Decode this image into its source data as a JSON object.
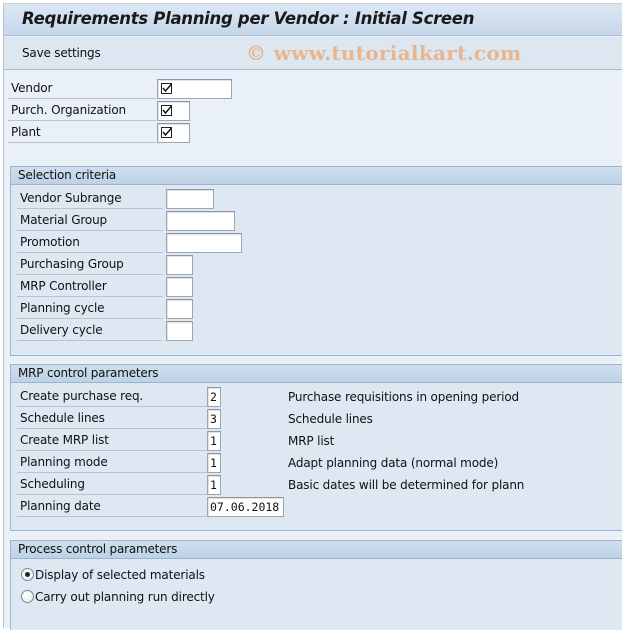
{
  "window": {
    "title": "Requirements Planning per Vendor : Initial Screen"
  },
  "toolbar": {
    "save_settings_label": "Save settings",
    "watermark": "© www.tutorialkart.com"
  },
  "top_fields": [
    {
      "label": "Vendor",
      "value": "checked",
      "icon": "checkbox-checked-icon"
    },
    {
      "label": "Purch. Organization",
      "value": "checked",
      "icon": "checkbox-checked-icon"
    },
    {
      "label": "Plant",
      "value": "checked",
      "icon": "checkbox-checked-icon"
    }
  ],
  "selection_criteria": {
    "title": "Selection criteria",
    "fields": [
      {
        "label": "Vendor Subrange",
        "value": ""
      },
      {
        "label": "Material Group",
        "value": ""
      },
      {
        "label": "Promotion",
        "value": ""
      },
      {
        "label": "Purchasing Group",
        "value": ""
      },
      {
        "label": "MRP Controller",
        "value": ""
      },
      {
        "label": "Planning cycle",
        "value": ""
      },
      {
        "label": "Delivery cycle",
        "value": ""
      }
    ]
  },
  "mrp_control": {
    "title": "MRP control parameters",
    "fields": [
      {
        "label": "Create purchase req.",
        "value": "2",
        "description": "Purchase requisitions in opening period"
      },
      {
        "label": "Schedule lines",
        "value": "3",
        "description": "Schedule lines"
      },
      {
        "label": "Create MRP list",
        "value": "1",
        "description": "MRP list"
      },
      {
        "label": "Planning mode",
        "value": "1",
        "description": "Adapt planning data (normal mode)"
      },
      {
        "label": "Scheduling",
        "value": "1",
        "description": "Basic dates will be determined for plann"
      },
      {
        "label": "Planning date",
        "value": "07.06.2018",
        "description": ""
      }
    ]
  },
  "process_control": {
    "title": "Process control parameters",
    "options": [
      {
        "label": "Display of selected materials",
        "selected": true
      },
      {
        "label": "Carry out planning run directly",
        "selected": false
      }
    ]
  }
}
